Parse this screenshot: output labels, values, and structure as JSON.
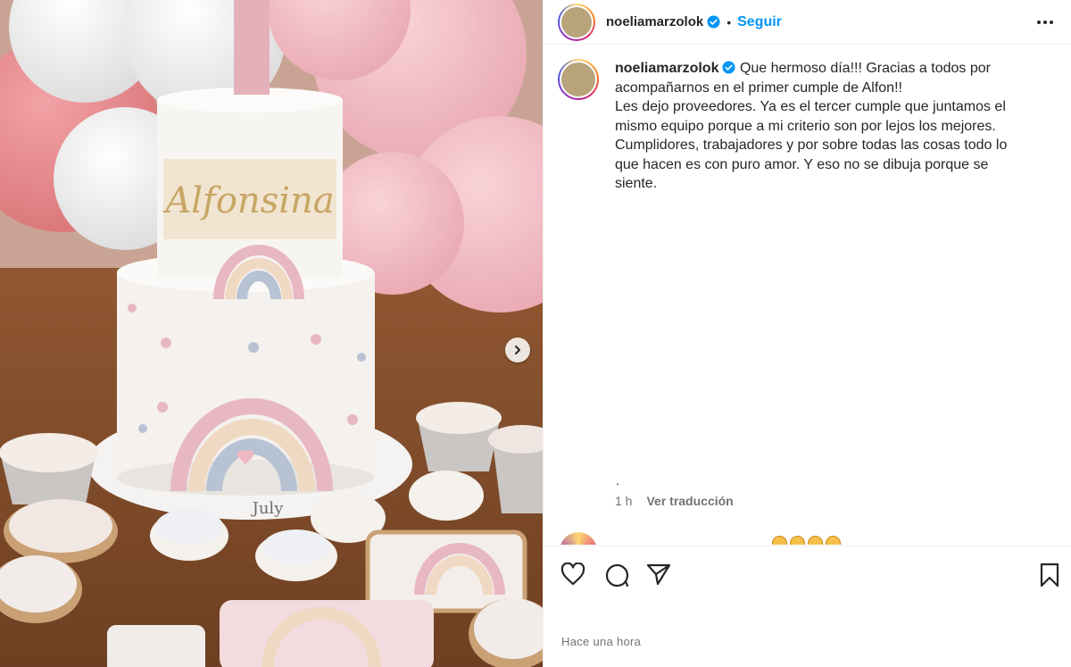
{
  "post": {
    "username": "noeliamarzolok",
    "follow_label": "Seguir",
    "separator": "•",
    "caption_lines": [
      "Que hermoso día!!! Gracias a todos por",
      "acompañarnos en el primer cumple de Alfon!!",
      "Les dejo proveedores. Ya es el tercer cumple que juntamos el",
      "mismo equipo porque a mi criterio son por lejos los mejores.",
      "Cumplidores, trabajadores y por sobre todas las cosas todo lo",
      "que hacen es con puro amor. Y eso no se dibuja porque se",
      "siente."
    ],
    "trailing_dot": ".",
    "relative_time": "1 h",
    "translate_label": "Ver traducción",
    "footer_time": "Hace una hora"
  },
  "photo": {
    "cake_name": "Alfonsina",
    "cake_tag": "July"
  },
  "icons": {
    "verified": "verified-badge-icon",
    "more": "more-options-icon",
    "next": "chevron-right-icon",
    "like": "heart-icon",
    "comment": "comment-icon",
    "share": "send-icon",
    "save": "bookmark-icon"
  },
  "colors": {
    "accent": "#0095f6",
    "text": "#262626",
    "muted": "#737373"
  }
}
